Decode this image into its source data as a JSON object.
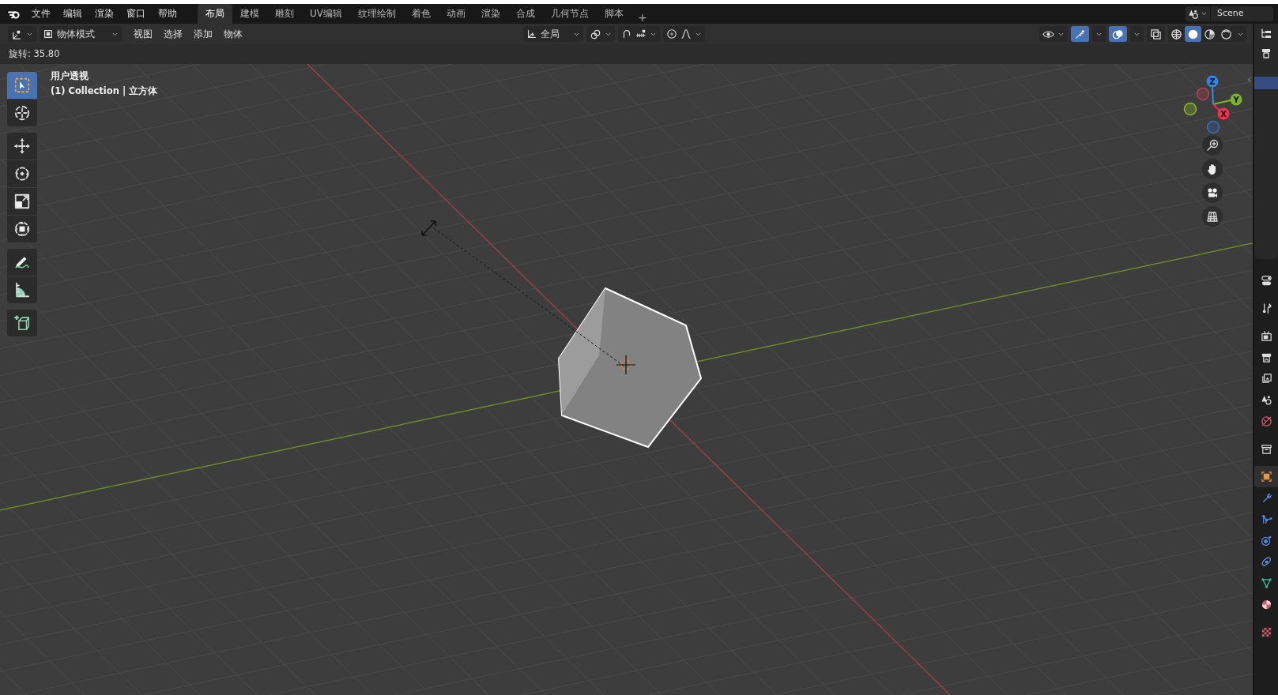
{
  "topbar": {
    "menus": [
      "文件",
      "编辑",
      "渲染",
      "窗口",
      "帮助"
    ],
    "workspaces": [
      {
        "label": "布局",
        "selected": true
      },
      {
        "label": "建模",
        "selected": false
      },
      {
        "label": "雕刻",
        "selected": false
      },
      {
        "label": "UV编辑",
        "selected": false
      },
      {
        "label": "纹理绘制",
        "selected": false
      },
      {
        "label": "着色",
        "selected": false
      },
      {
        "label": "动画",
        "selected": false
      },
      {
        "label": "渲染",
        "selected": false
      },
      {
        "label": "合成",
        "selected": false
      },
      {
        "label": "几何节点",
        "selected": false
      },
      {
        "label": "脚本",
        "selected": false
      }
    ],
    "add_tab": "+",
    "scene": "Scene"
  },
  "header": {
    "mode": "物体模式",
    "menus": [
      "视图",
      "选择",
      "添加",
      "物体"
    ],
    "orientation": "全局",
    "gizmos": {
      "on": true
    },
    "overlays": {
      "on": true
    },
    "xray": {
      "on": false
    },
    "shading": [
      {
        "selected": false
      },
      {
        "selected": true
      },
      {
        "selected": false
      },
      {
        "selected": false
      }
    ]
  },
  "operator": "旋转: 35.80",
  "viewport": {
    "view_name": "用户透视",
    "object_info": "(1) Collection | 立方体",
    "gizmo_axes": [
      "Z",
      "Y",
      "X"
    ]
  },
  "toolbar": [
    [
      {
        "selected": true
      },
      {
        "selected": false
      }
    ],
    [
      {
        "selected": false
      },
      {
        "selected": false
      },
      {
        "selected": false
      },
      {
        "selected": false
      }
    ],
    [
      {
        "selected": false
      },
      {
        "selected": false
      }
    ],
    [
      {
        "selected": false
      }
    ]
  ],
  "outliner": {
    "rows": [
      {
        "selected": true
      }
    ]
  },
  "properties_tabs": [
    {
      "selected": false
    },
    {
      "selected": false
    },
    {
      "selected": false
    },
    {
      "selected": false
    },
    {
      "selected": false
    },
    {
      "selected": false
    },
    {
      "selected": false
    },
    {
      "selected": false
    },
    {
      "selected": true
    },
    {
      "selected": false
    },
    {
      "selected": false
    },
    {
      "selected": false
    },
    {
      "selected": false
    },
    {
      "selected": false
    },
    {
      "selected": false
    },
    {
      "selected": false
    }
  ]
}
